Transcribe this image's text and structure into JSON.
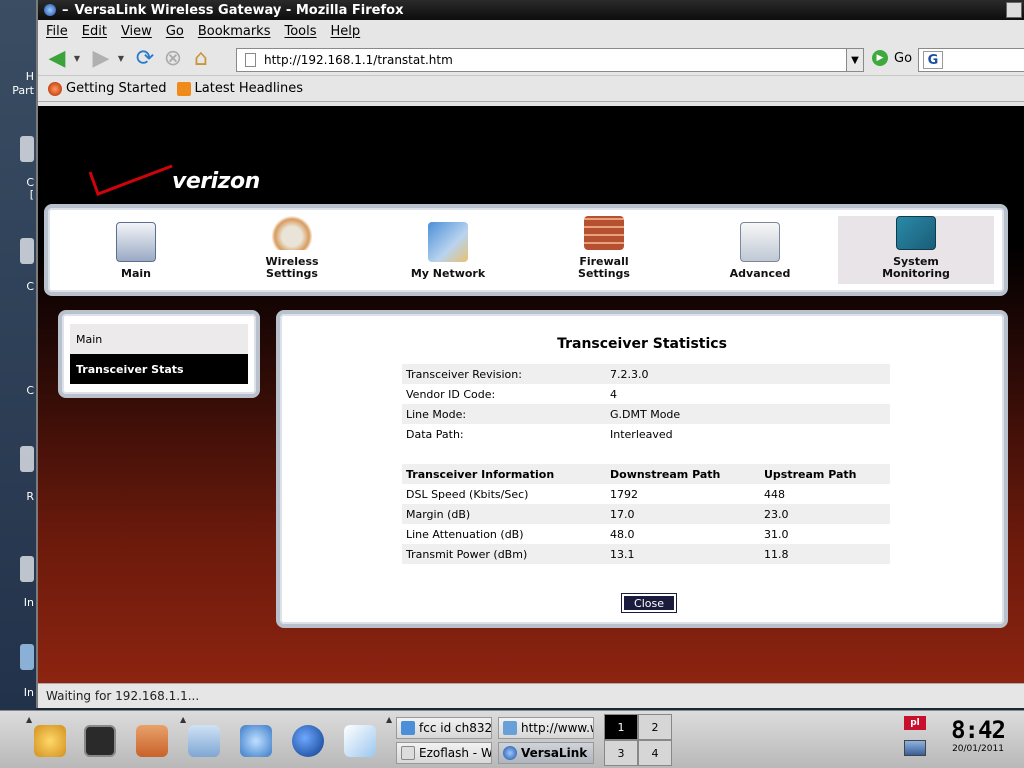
{
  "desktop": {
    "icons": [
      "H\nPart",
      "C\n[",
      "C",
      "C",
      "R",
      "In",
      "In"
    ]
  },
  "window": {
    "title": "VersaLink Wireless Gateway - Mozilla Firefox"
  },
  "menu": [
    "File",
    "Edit",
    "View",
    "Go",
    "Bookmarks",
    "Tools",
    "Help"
  ],
  "navbar": {
    "url": "http://192.168.1.1/transtat.htm",
    "go_label": "Go",
    "search_engine": "G"
  },
  "bookmarks": [
    {
      "label": "Getting Started",
      "icon": "firefox-icon"
    },
    {
      "label": "Latest Headlines",
      "icon": "rss-icon"
    }
  ],
  "logo": {
    "text": "verizon"
  },
  "topnav": [
    {
      "label": "Main",
      "icon": "main-icon"
    },
    {
      "label": "Wireless\nSettings",
      "icon": "wireless-icon"
    },
    {
      "label": "My Network",
      "icon": "network-icon"
    },
    {
      "label": "Firewall\nSettings",
      "icon": "firewall-icon"
    },
    {
      "label": "Advanced",
      "icon": "advanced-icon"
    },
    {
      "label": "System\nMonitoring",
      "icon": "system-monitoring-icon",
      "active": true
    }
  ],
  "sidebar": {
    "items": [
      {
        "label": "Main"
      },
      {
        "label": "Transceiver Stats",
        "active": true
      }
    ]
  },
  "panel": {
    "title": "Transceiver Statistics",
    "info_rows": [
      {
        "label": "Transceiver Revision:",
        "value": "7.2.3.0"
      },
      {
        "label": "Vendor ID Code:",
        "value": "4"
      },
      {
        "label": "Line Mode:",
        "value": "G.DMT Mode"
      },
      {
        "label": "Data Path:",
        "value": "Interleaved"
      }
    ],
    "table_headers": [
      "Transceiver Information",
      "Downstream Path",
      "Upstream Path"
    ],
    "table_rows": [
      {
        "label": "DSL Speed (Kbits/Sec)",
        "down": "1792",
        "up": "448"
      },
      {
        "label": "Margin (dB)",
        "down": "17.0",
        "up": "23.0"
      },
      {
        "label": "Line Attenuation (dB)",
        "down": "48.0",
        "up": "31.0"
      },
      {
        "label": "Transmit Power (dBm)",
        "down": "13.1",
        "up": "11.8"
      }
    ],
    "close_label": "Close"
  },
  "status": {
    "text": "Waiting for 192.168.1.1..."
  },
  "taskbar": {
    "tasks": [
      {
        "label": "fcc id ch832",
        "icon": "google-icon"
      },
      {
        "label": "http://www.w",
        "icon": "browser-icon"
      },
      {
        "label": "Ezoflash - W",
        "icon": "ezoflash-icon"
      },
      {
        "label": "VersaLink",
        "icon": "firefox-icon",
        "active": true
      }
    ],
    "pager": [
      "1",
      "2",
      "3",
      "4"
    ],
    "active_desktop": "1",
    "keyboard_layout": "pl",
    "clock_time": "8:42",
    "clock_date": "20/01/2011"
  },
  "colors": {
    "verizon_red": "#cd040b",
    "active_sidebar": "#000000",
    "close_button": "#1b1b3e"
  }
}
